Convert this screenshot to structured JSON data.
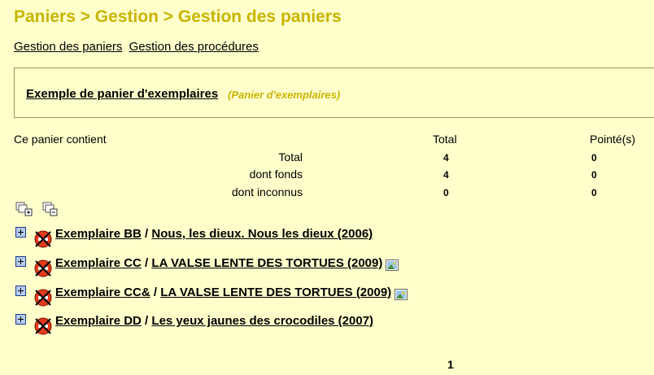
{
  "breadcrumb": "Paniers > Gestion > Gestion des paniers",
  "tabs": [
    {
      "label": "Gestion des paniers"
    },
    {
      "label": "Gestion des procédures"
    }
  ],
  "basket": {
    "name": "Exemple de panier d'exemplaires",
    "type": "(Panier d'exemplaires)"
  },
  "stats": {
    "contains_label": "Ce panier contient",
    "total_header": "Total",
    "pointed_header": "Pointé(s)",
    "rows": [
      {
        "label": "Total",
        "total": "4",
        "pointed": "0"
      },
      {
        "label": "dont fonds",
        "total": "4",
        "pointed": "0"
      },
      {
        "label": "dont inconnus",
        "total": "0",
        "pointed": "0"
      }
    ]
  },
  "items": [
    {
      "exemplaire": "Exemplaire BB",
      "sep": " / ",
      "title": "Nous, les dieux. Nous les dieux (2006)",
      "has_image": false
    },
    {
      "exemplaire": "Exemplaire CC",
      "sep": " / ",
      "title": "LA VALSE LENTE DES TORTUES (2009)",
      "has_image": true
    },
    {
      "exemplaire": "Exemplaire CC&",
      "sep": " / ",
      "title": "LA VALSE LENTE DES TORTUES (2009)",
      "has_image": true
    },
    {
      "exemplaire": "Exemplaire DD",
      "sep": " / ",
      "title": "Les yeux jaunes des crocodiles (2007)",
      "has_image": false
    }
  ],
  "pager": {
    "current": "1"
  },
  "icons": {
    "expand": "plus-box-icon",
    "delete": "no-entry-icon",
    "image": "picture-icon",
    "actions": [
      "copy-add-icon",
      "copy-remove-icon"
    ]
  },
  "colors": {
    "background": "#ffffcc",
    "title": "#c8b400",
    "border": "#8c9a52"
  }
}
